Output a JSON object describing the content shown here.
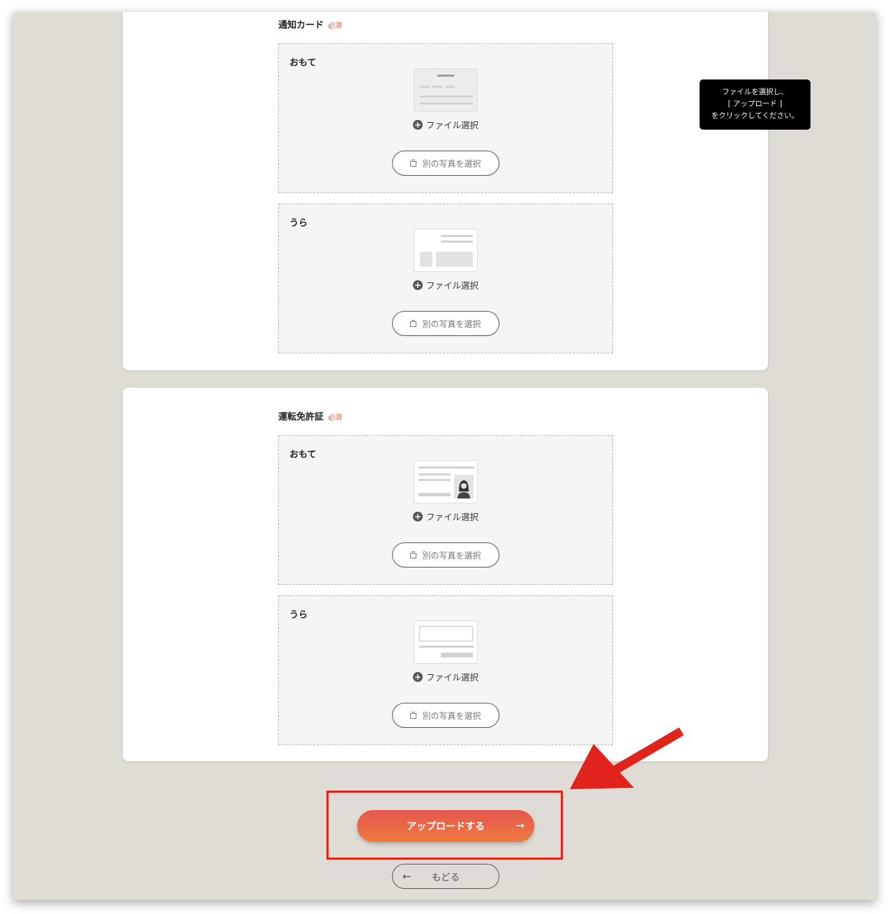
{
  "tooltip": {
    "line1": "ファイルを選択し、",
    "line2": "[ アップロード ]",
    "line3": "をクリックしてください。"
  },
  "sections": [
    {
      "title": "通知カード",
      "required": "必須",
      "boxes": [
        {
          "label": "おもて",
          "file_select": "ファイル選択",
          "alt_button": "別の写真を選択",
          "icon": "notification-card-front-icon"
        },
        {
          "label": "うら",
          "file_select": "ファイル選択",
          "alt_button": "別の写真を選択",
          "icon": "notification-card-back-icon"
        }
      ]
    },
    {
      "title": "運転免許証",
      "required": "必須",
      "boxes": [
        {
          "label": "おもて",
          "file_select": "ファイル選択",
          "alt_button": "別の写真を選択",
          "icon": "drivers-license-front-icon"
        },
        {
          "label": "うら",
          "file_select": "ファイル選択",
          "alt_button": "別の写真を選択",
          "icon": "drivers-license-back-icon"
        }
      ]
    }
  ],
  "actions": {
    "upload": "アップロードする",
    "back": "もどる",
    "upload_arrow": "→",
    "back_arrow": "←"
  },
  "colors": {
    "background": "#dfdcd5",
    "required": "#e8553a",
    "upload_gradient_start": "#e4564f",
    "upload_gradient_end": "#ef7b3f",
    "annotation_red": "#e0241b"
  }
}
